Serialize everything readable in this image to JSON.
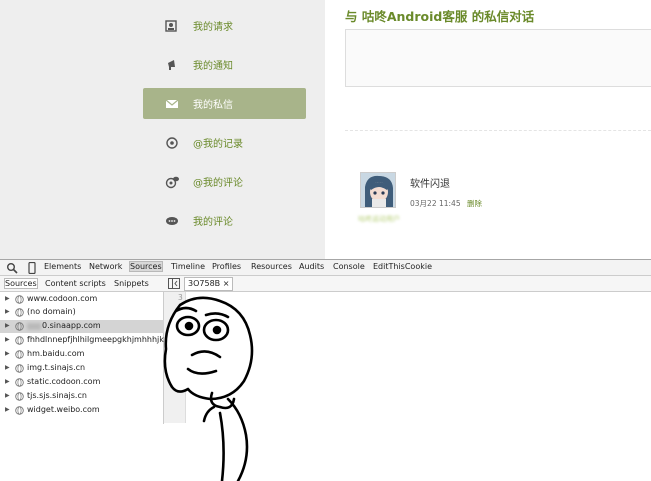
{
  "webpage": {
    "nav": [
      {
        "label": "我的请求",
        "icon": "person-card-icon"
      },
      {
        "label": "我的通知",
        "icon": "megaphone-icon"
      },
      {
        "label": "我的私信",
        "icon": "envelope-icon",
        "active": true
      },
      {
        "label": "@我的记录",
        "icon": "at-sign-icon"
      },
      {
        "label": "@我的评论",
        "icon": "at-bubble-icon"
      },
      {
        "label": "我的评论",
        "icon": "chat-bubble-icon"
      }
    ],
    "conversation_title": "与 咕咚Android客服 的私信对话",
    "message": {
      "text": "软件闪退",
      "time": "03月22 11:45",
      "delete_label": "删除",
      "user_name_blurred": "咕咚运动用户"
    },
    "colors": {
      "accent": "#6a8a2a",
      "active_nav_bg": "#a8b48a",
      "sidebar_bg": "#eeeeee"
    }
  },
  "devtools": {
    "tabs": [
      "Elements",
      "Network",
      "Sources",
      "Timeline",
      "Profiles",
      "Resources",
      "Audits",
      "Console",
      "EditThisCookie"
    ],
    "selected_tab": "Sources",
    "navigator_tabs": [
      "Sources",
      "Content scripts",
      "Snippets"
    ],
    "selected_navigator_tab": "Sources",
    "tree": [
      "www.codoon.com",
      "(no domain)",
      "0.sinaapp.com",
      "fhhdlnnepfjhlhilgmeepgkhjmhhhjk",
      "hm.baidu.com",
      "img.t.sinajs.cn",
      "static.codoon.com",
      "tjs.sjs.sinajs.cn",
      "widget.weibo.com"
    ],
    "selected_tree_index": 2,
    "open_file_tab": "3O758B ×",
    "gutter_line": "3"
  }
}
